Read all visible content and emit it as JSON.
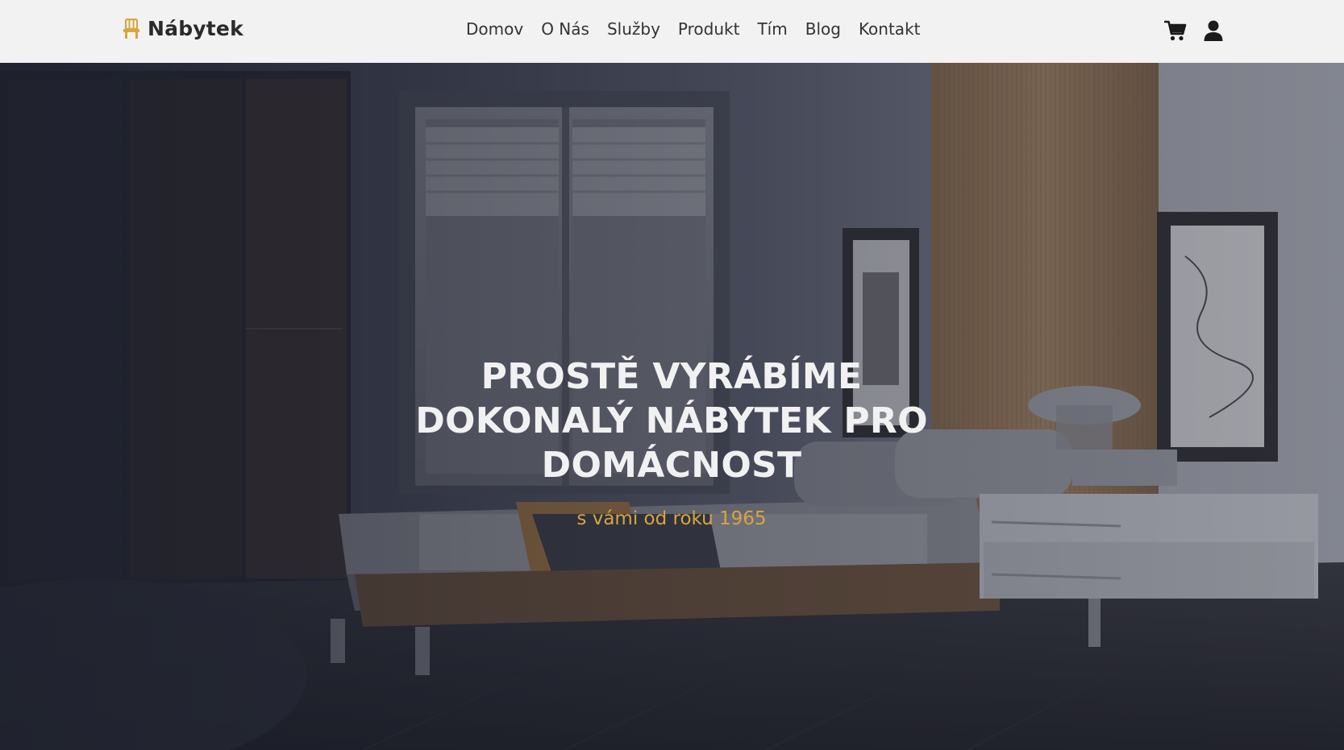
{
  "brand": {
    "name": "Nábytek",
    "icon": "chair-icon",
    "accent_color": "#d9a441"
  },
  "nav": {
    "items": [
      {
        "label": "Domov"
      },
      {
        "label": "O Nás"
      },
      {
        "label": "Služby"
      },
      {
        "label": "Produkt"
      },
      {
        "label": "Tím"
      },
      {
        "label": "Blog"
      },
      {
        "label": "Kontakt"
      }
    ],
    "icons": [
      "cart-icon",
      "user-icon"
    ]
  },
  "hero": {
    "title": "PROSTĚ VYRÁBÍME DOKONALÝ NÁBYTEK PRO DOMÁCNOST",
    "subtitle": "s vámi od roku 1965"
  },
  "colors": {
    "header_bg": "#f2f2f2",
    "title_text": "#f1f1f1",
    "subtitle_text": "#d9a441"
  }
}
